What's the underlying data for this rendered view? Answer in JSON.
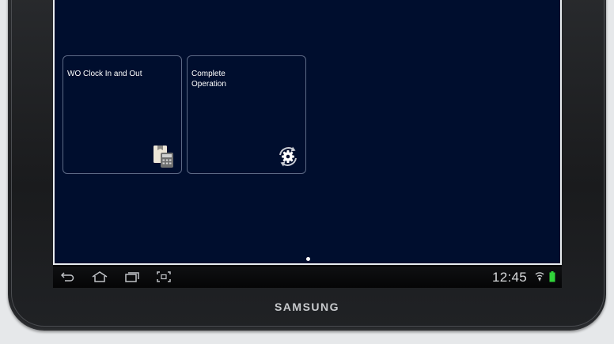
{
  "tiles": [
    {
      "title": "WO Clock In and Out",
      "icon": "clipboard-calculator-icon"
    },
    {
      "title": "Complete\nOperation",
      "icon": "gear-sync-icon"
    }
  ],
  "status_bar": {
    "time": "12:45",
    "icons": [
      "wifi-icon",
      "battery-icon"
    ]
  },
  "nav_icons": [
    "back-icon",
    "home-icon",
    "recent-apps-icon",
    "screenshot-icon"
  ],
  "device": {
    "brand": "SAMSUNG"
  },
  "colors": {
    "app_background": "#000e2e",
    "tile_border": "#5d6a86",
    "battery": "#31d33a"
  }
}
